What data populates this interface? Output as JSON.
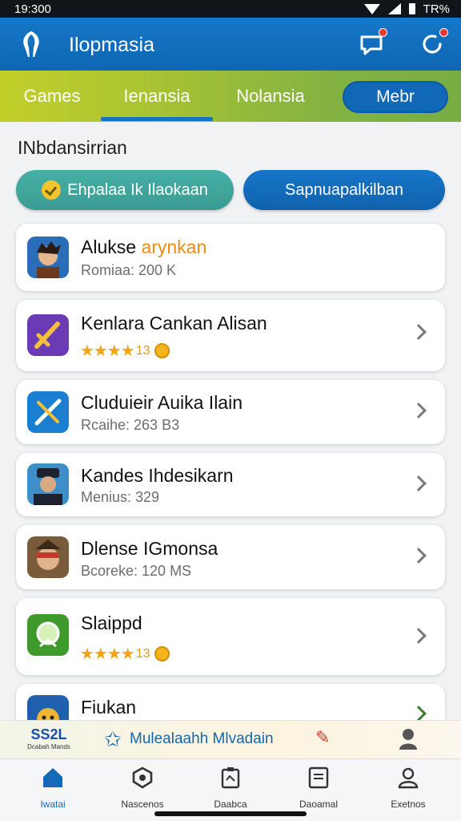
{
  "status": {
    "time": "19:300",
    "battery": "TR%"
  },
  "header": {
    "title": "Ilopmasia",
    "notification_icon": "chat-bubble-icon",
    "sync_icon": "refresh-icon"
  },
  "tabs": [
    {
      "label": "Games",
      "active": false
    },
    {
      "label": "Ienansia",
      "active": true
    },
    {
      "label": "Nolansia",
      "active": false
    },
    {
      "label": "Mebr",
      "active": false,
      "style": "pill"
    }
  ],
  "section": {
    "title": "INbdansirrian"
  },
  "chips": [
    {
      "label": "Ehpalaa Ik Ilaokaan",
      "icon": "check-coin-icon"
    },
    {
      "label": "Sapnuapalkilban"
    }
  ],
  "apps": [
    {
      "title": "Alukse",
      "title_accent": "arynkan",
      "subtitle": "Romiaa: 200 K",
      "icon": "hero-avatar-icon"
    },
    {
      "title": "Kenlara Cankan Alisan",
      "rating": 4,
      "rating_text": "13",
      "icon": "sword-purple-icon"
    },
    {
      "title": "Cluduieir Auika Ilain",
      "subtitle": "Rcaihe: 263 B3",
      "icon": "sword-blue-icon"
    },
    {
      "title": "Kandes Ihdesikarn",
      "subtitle": "Menius: 329",
      "icon": "gentleman-avatar-icon"
    },
    {
      "title": "Dlense IGmonsa",
      "subtitle": "Bcoreke: 120 MS",
      "icon": "masked-warrior-icon"
    },
    {
      "title": "Slaippd",
      "rating": 4,
      "rating_text": "13",
      "icon": "green-badge-icon"
    },
    {
      "title": "Fiukan",
      "icon": "blue-character-icon"
    }
  ],
  "promo": {
    "logo_text": "SS2L",
    "logo_sub": "Dcabah Mands",
    "text": "Mulealaahh Mlvadain",
    "star_icon": "star-outline-icon",
    "edit_icon": "edit-star-icon",
    "person_icon": "person-icon"
  },
  "nav": [
    {
      "label": "Iwatai",
      "icon": "home-icon",
      "active": true
    },
    {
      "label": "Nascenos",
      "icon": "shield-icon",
      "active": false
    },
    {
      "label": "Daabca",
      "icon": "clipboard-icon",
      "active": false
    },
    {
      "label": "Daoamal",
      "icon": "document-icon",
      "active": false
    },
    {
      "label": "Exetnos",
      "icon": "profile-icon",
      "active": false
    }
  ],
  "colors": {
    "appbar": "#1578c8",
    "tabbar": "#a7c233",
    "accent": "#f08a12",
    "chip_teal": "#47b0a6",
    "chip_blue": "#1675c8"
  }
}
